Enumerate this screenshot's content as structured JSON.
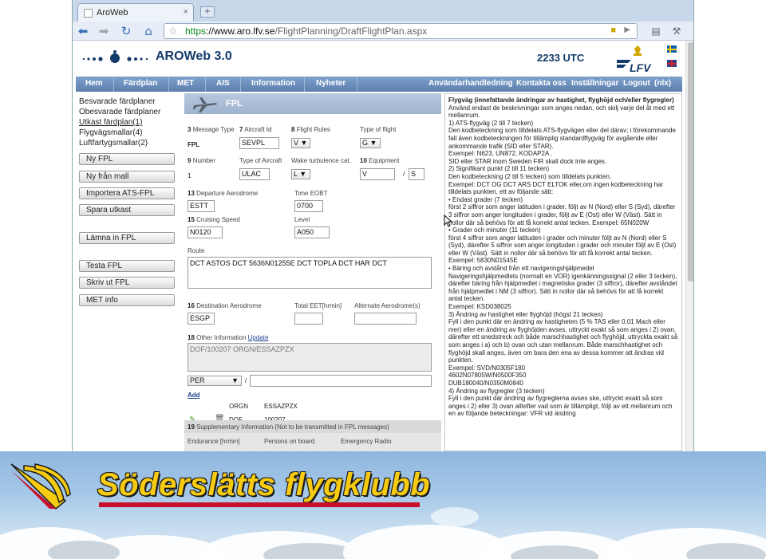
{
  "browser": {
    "tab_title": "AroWeb",
    "tab_close": "×",
    "newtab": "+",
    "url_scheme": "https",
    "url_host": "://www.aro.lfv.se",
    "url_path": "/FlightPlanning/DraftFlightPlan.aspx",
    "icons": [
      "back-icon",
      "forward-icon",
      "reload-icon",
      "home-icon",
      "star-icon",
      "lock-icon",
      "page-icon",
      "wrench-icon"
    ]
  },
  "header": {
    "title": "AROWeb 3.0",
    "utc_time": "2233 UTC",
    "logo_text": "LFV"
  },
  "nav": {
    "items": [
      "Hem",
      "Färdplan",
      "MET",
      "AIS",
      "Information",
      "Nyheter"
    ],
    "right_items": [
      "Användarhandledning",
      "Kontakta oss",
      "Inställningar",
      "Logout",
      "(nlx)"
    ]
  },
  "leftmenu": {
    "links": [
      "Besvarade färdplaner",
      "Obesvarade färdplaner",
      "Utkast färdplan(1)",
      "Flygvägsmallar(4)",
      "Luftfartygsmallar(2)"
    ],
    "buttons": [
      "Ny FPL",
      "Ny från mall",
      "Importera ATS-FPL",
      "Spara utkast",
      "Lämna in FPL",
      "Testa FPL",
      "Skriv ut FPL",
      "MET info"
    ]
  },
  "form": {
    "heading": "FPL",
    "f3_num": "3",
    "f3_label": "Message Type",
    "f3_value": "FPL",
    "f7_num": "7",
    "f7_label": "Aircraft Id",
    "f7_value": "SEVPL",
    "f8_num": "8",
    "f8_label": "Flight Rules",
    "f8_value": "V",
    "type_flight_label": "Type of flight",
    "type_flight_value": "G",
    "f9_num": "9",
    "f9_label": "Number",
    "f9_value": "1",
    "type_aircraft_label": "Type of Aircraft",
    "type_aircraft_value": "ULAC",
    "wake_label": "Wake turbulence cat.",
    "wake_value": "L",
    "f10_num": "10",
    "f10_label": "Equipment",
    "f10_value_a": "V",
    "f10_slash": "/",
    "f10_value_b": "S",
    "f13_num": "13",
    "f13_label": "Departure Aerodrome",
    "f13_value": "ESTT",
    "eobt_label": "Time EOBT",
    "eobt_value": "0700",
    "f15_num": "15",
    "f15_label": "Cruising Speed",
    "f15_value": "N0120",
    "level_label": "Level",
    "level_value": "A050",
    "route_label": "Route",
    "route_value": "DCT ASTOS DCT 5636N01255E DCT TOPLA DCT HAR DCT",
    "f16_num": "16",
    "f16_label": "Destination Aerodrome",
    "f16_value": "ESGP",
    "eet_label": "Total EET[hrmin]",
    "alt_label": "Alternate Aerodrome(s)",
    "f18_num": "18",
    "f18_label": "Other Information",
    "f18_update": "Update",
    "f18_value": "DOF/100207 ORGN/ESSAZPZX",
    "per_value": "PER",
    "add_label": "Add",
    "orgn_key": "ORGN",
    "orgn_value": "ESSAZPZX",
    "dof_key": "DOF",
    "dof_value": "100207",
    "f19_num": "19",
    "f19_label": "Supplementary Information (Not to be transmitted in FPL messages)",
    "endurance_label": "Endurance [hrmin]",
    "pob_label": "Persons on board",
    "radio_label": "Emergency Radio"
  },
  "help": [
    {
      "bold": true,
      "text": "Flygväg (innefattande ändringar av hastighet, flyghöjd och/eller flygregler)"
    },
    {
      "bold": false,
      "text": "Använd endast de beskrivningar som anges nedan, och skilj varje del åt med ett mellanrum."
    },
    {
      "bold": false,
      "text": "1) ATS-flygväg (2 till 7 tecken)"
    },
    {
      "bold": false,
      "text": "Den kodbeteckning som tilldelats ATS-flygvägen eller del därav; i förekommande fall även kodbeteckningen för tillämplig standardflygväg för avgående eller ankommande trafik (SID eller STAR)."
    },
    {
      "bold": false,
      "text": "Exempel: N623, UN872, KODAP2A ."
    },
    {
      "bold": false,
      "text": "SID eller STAR inom Sweden FIR skall dock inte anges."
    },
    {
      "bold": false,
      "text": "2) Signifikant punkt (2 till 11 tecken)"
    },
    {
      "bold": false,
      "text": "Den kodbeteckning (2 till 5 tecken) som tilldelats punkten."
    },
    {
      "bold": false,
      "text": "Exempel: DCT OG DCT ARS DCT ELTOK eller,om ingen kodbeteckning har tilldelats punkten, ett av följande sätt:"
    },
    {
      "bold": false,
      "text": "• Endast grader (7 tecken)"
    },
    {
      "bold": false,
      "text": "först 2 siffror som anger latituden i grader, följt av N (Nord) eller S (Syd), därefter 3 siffror som anger longituden i grader, följt av E (Ost) eller W (Väst). Sätt in nollor där så behövs för att få korrekt antal tecken. Exempel: 65N020W"
    },
    {
      "bold": false,
      "text": "• Grader och minuter (11 tecken)"
    },
    {
      "bold": false,
      "text": "först 4 siffror som anger latituden i grader och minuter följt av N (Nord) eller S (Syd), därefter 5 siffror som anger longituden i grader och minuter följt av E (Ost) eller W (Väst). Sätt in nollor där så behövs för att få korrekt antal tecken."
    },
    {
      "bold": false,
      "text": "Exempel: 5830N01545E"
    },
    {
      "bold": false,
      "text": "• Bäring och avstånd från ett navigeringshjälpmedel"
    },
    {
      "bold": false,
      "text": "Navigeringshjälpmedlets (normalt en VOR) igenkänningssignal (2 eller 3 tecken), därefter bäring från hjälpmedlet i magnetiska grader (3 siffror), därefter avståndet från hjälpmedlet i NM (3 siffror). Sätt in nollor där så behövs för att få korrekt antal tecken."
    },
    {
      "bold": false,
      "text": "Exempel: KSD038025"
    },
    {
      "bold": false,
      "text": "3) Ändring av hastighet eller flyghöjd (högst 21 tecken)"
    },
    {
      "bold": false,
      "text": "Fyll i den punkt där en ändring av hastigheten (5 % TAS eller 0,01 Mach eller mer) eller en ändring av flyghöjden avses, uttryckt exakt så som anges i 2) ovan, därefter ett snedstreck och både marschhastighet och flyghöjd, uttryckta exakt så som anges i a) och b) ovan och utan mellanrum. Både marschhastighet och flyghöjd skall anges, även om bara den ena av dessa kommer att ändras vid punkten."
    },
    {
      "bold": false,
      "text": "Exempel: SVD/N0305F180"
    },
    {
      "bold": false,
      "text": "4602N07805W/N0500F350"
    },
    {
      "bold": false,
      "text": "DUB180040/N0350M0840"
    },
    {
      "bold": false,
      "text": "4) Ändring av flygregler (3 tecken)"
    },
    {
      "bold": false,
      "text": "Fyll i den punkt där ändring av flygreglerna avses ske, uttryckt exakt så som anges i 2) eller 3) ovan alltefter vad som är tillämpligt, följt av ett mellanrum och en av följande beteckningar: VFR vid ändring"
    }
  ],
  "banner": {
    "club_name": "Söderslätts flygklubb"
  },
  "colors": {
    "nav_bg": "#5b7fb0",
    "title_blue": "#123a6b",
    "club_yellow": "#f6cb12",
    "club_red": "#c8102e"
  }
}
